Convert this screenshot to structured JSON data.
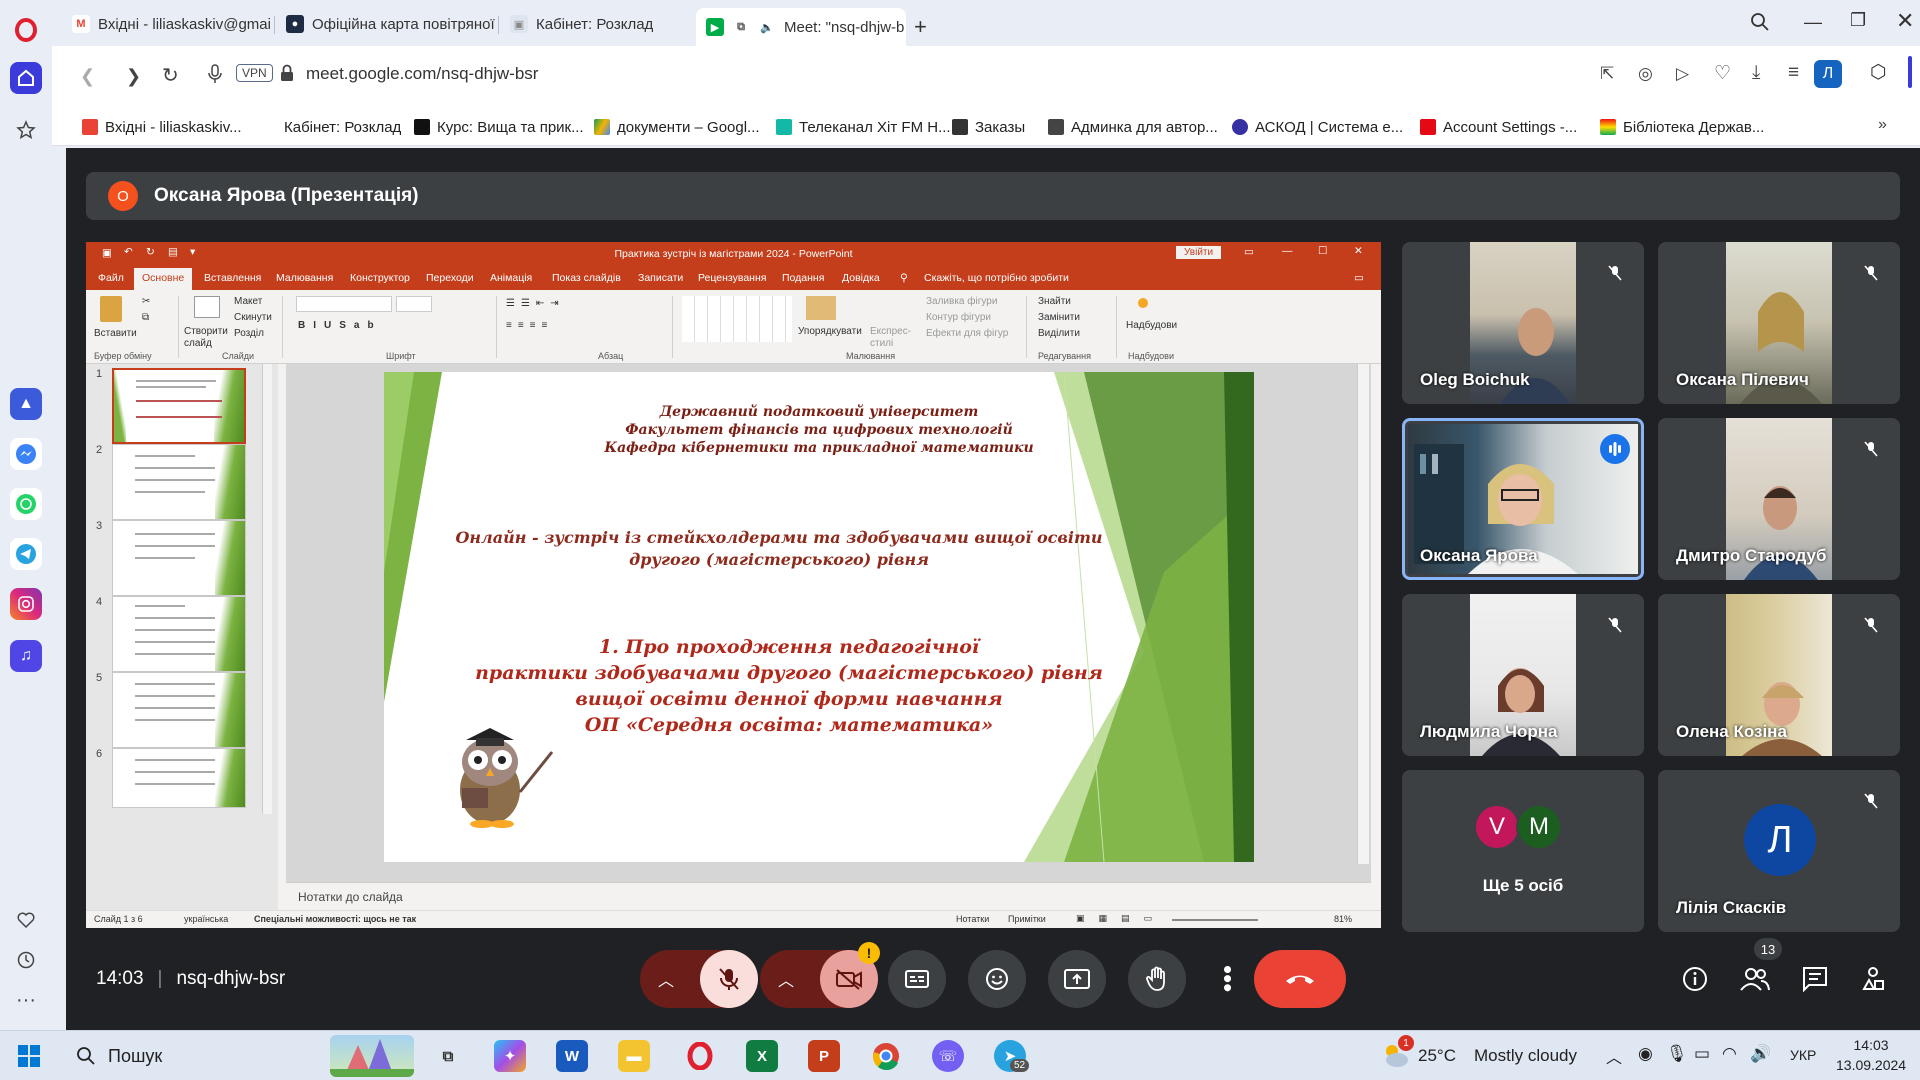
{
  "browser": {
    "tabs": [
      {
        "label": "Вхідні - liliaskaskiv@gmail",
        "icon": "gmail-icon"
      },
      {
        "label": "Офіційна карта повітряної",
        "icon": "map-icon"
      },
      {
        "label": "Кабінет: Розклад",
        "icon": "schedule-icon"
      },
      {
        "label": "Meet: \"nsq-dhjw-b",
        "icon": "meet-icon"
      }
    ],
    "url": "meet.google.com/nsq-dhjw-bsr",
    "vpn_label": "VPN",
    "profile_letter": "Л",
    "bookmarks": [
      "Вхідні - liliaskaskiv...",
      "Кабінет: Розклад",
      "Курс: Вища та прик...",
      "документи – Googl...",
      "Телеканал Хіт FM Н...",
      "Заказы",
      "Админка для автор...",
      "АСКОД | Система е...",
      "Account Settings -...",
      "Бібліотека Держав..."
    ]
  },
  "meet": {
    "presenter_initial": "О",
    "presenter_title": "Оксана Ярова (Презентація)",
    "time": "14:03",
    "meeting_code": "nsq-dhjw-bsr",
    "people_count": "13",
    "participants": [
      {
        "name": "Oleg Boichuk",
        "muted": true
      },
      {
        "name": "Оксана Пілевич",
        "muted": true
      },
      {
        "name": "Оксана Ярова",
        "muted": false
      },
      {
        "name": "Дмитро Стародуб",
        "muted": true
      },
      {
        "name": "Людмила Чорна",
        "muted": true
      },
      {
        "name": "Олена Козіна",
        "muted": true
      }
    ],
    "others": {
      "initials": [
        "V",
        "M"
      ],
      "label": "Ще 5 осіб"
    },
    "lilia": {
      "initial": "Л",
      "name": "Лілія Скаскiв"
    }
  },
  "ppt": {
    "title": "Практика зустріч із магістрами 2024  -  PowerPoint",
    "signin": "Увійти",
    "menu": [
      "Файл",
      "Основне",
      "Вставлення",
      "Малювання",
      "Конструктор",
      "Переходи",
      "Анімація",
      "Показ слайдів",
      "Записати",
      "Рецензування",
      "Подання",
      "Довідка"
    ],
    "tell_me": "Скажіть, що потрібно зробити",
    "ribbon": {
      "paste": "Вставити",
      "clipboard": "Буфер обміну",
      "new_slide": "Створити слайд",
      "layout": "Макет",
      "reset": "Скинути",
      "section": "Розділ",
      "slides": "Слайди",
      "font": "Шрифт",
      "paragraph": "Абзац",
      "arrange": "Упорядкувати",
      "express": "Експрес-стилі",
      "fill": "Заливка фігури",
      "outline": "Контур фігури",
      "effects": "Ефекти для фігур",
      "drawing": "Малювання",
      "find": "Знайти",
      "replace": "Замінити",
      "select": "Виділити",
      "editing": "Редагування",
      "addins": "Надбудови",
      "addins_group": "Надбудови"
    },
    "slide": {
      "header": [
        "Державний податковий університет",
        "Факультет фінансів та цифрових технологій",
        "Кафедра кібернетики та прикладної математики"
      ],
      "subtitle": [
        "Онлайн - зустріч із стейкхолдерами та здобувачами вищої освіти",
        "другого (магістерського) рівня"
      ],
      "topic": [
        "1. Про проходження педагогічної",
        "практики здобувачами другого (магістерського) рівня",
        "вищої освіти денної форми навчання",
        "ОП «Середня освіта: математика»"
      ]
    },
    "thumb_numbers": [
      "1",
      "2",
      "3",
      "4",
      "5",
      "6"
    ],
    "notes_placeholder": "Нотатки до слайда",
    "status": {
      "slide_of": "Слайд 1 з 6",
      "lang": "українська",
      "access": "Спеціальні можливості: щось не так",
      "notes": "Нотатки",
      "comments": "Примітки",
      "zoom": "81%"
    }
  },
  "taskbar": {
    "search": "Пошук",
    "weather_temp": "25°C",
    "weather_text": "Mostly cloudy",
    "lang": "УКР",
    "time": "14:03",
    "date": "13.09.2024",
    "telegram_badge": "52",
    "weather_badge": "1"
  }
}
